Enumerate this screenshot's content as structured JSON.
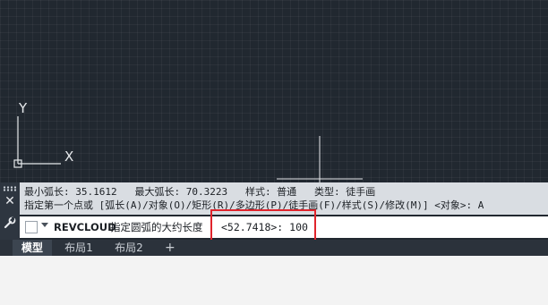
{
  "canvas": {
    "ucs_x_label": "X",
    "ucs_y_label": "Y"
  },
  "command_window": {
    "history": [
      "最小弧长: 35.1612   最大弧长: 70.3223   样式: 普通   类型: 徒手画",
      "指定第一个点或 [弧长(A)/对象(O)/矩形(R)/多边形(P)/徒手画(F)/样式(S)/修改(M)] <对象>: A"
    ],
    "prompt": {
      "command": "REVCLOUD",
      "text": "指定圆弧的大约长度",
      "value": "<52.7418>: 100"
    }
  },
  "layout_tabs": {
    "tabs": [
      "模型",
      "布局1",
      "布局2"
    ],
    "active": "模型",
    "add": "+"
  }
}
